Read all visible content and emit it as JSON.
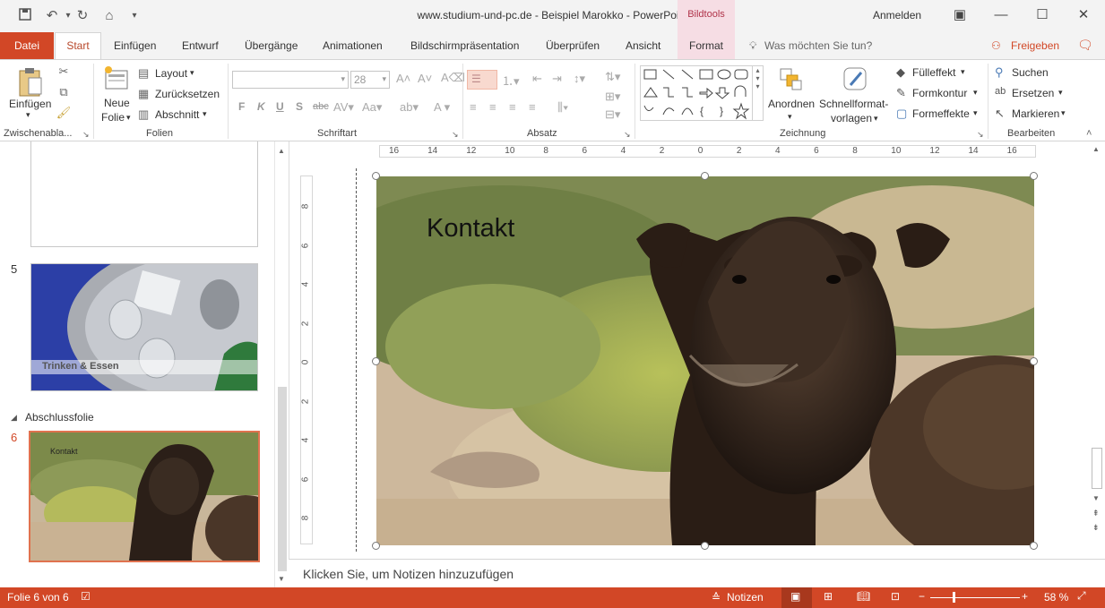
{
  "window": {
    "title": "www.studium-und-pc.de - Beispiel Marokko  -  PowerPoint",
    "contextual_group": "Bildtools",
    "sign_in": "Anmelden"
  },
  "tabs": {
    "file": "Datei",
    "items": [
      "Start",
      "Einfügen",
      "Entwurf",
      "Übergänge",
      "Animationen",
      "Bildschirmpräsentation",
      "Überprüfen",
      "Ansicht"
    ],
    "format": "Format",
    "tell_me": "Was möchten Sie tun?",
    "share": "Freigeben"
  },
  "ribbon": {
    "clipboard": {
      "paste": "Einfügen",
      "label": "Zwischenabla..."
    },
    "slides": {
      "new_slide_1": "Neue",
      "new_slide_2": "Folie",
      "layout": "Layout",
      "reset": "Zurücksetzen",
      "section": "Abschnitt",
      "label": "Folien"
    },
    "font": {
      "size": "28",
      "label": "Schriftart",
      "bold": "F",
      "italic": "K",
      "underline": "U",
      "shadow": "S",
      "strike": "abc"
    },
    "paragraph": {
      "label": "Absatz"
    },
    "drawing": {
      "arrange": "Anordnen",
      "quick_styles_1": "Schnellformat-",
      "quick_styles_2": "vorlagen",
      "fill": "Fülleffekt",
      "outline": "Formkontur",
      "effects": "Formeffekte",
      "label": "Zeichnung"
    },
    "editing": {
      "find": "Suchen",
      "replace": "Ersetzen",
      "select": "Markieren",
      "label": "Bearbeiten"
    }
  },
  "thumbnails": {
    "slide5_num": "5",
    "slide5_caption": "Trinken & Essen",
    "section_name": "Abschlussfolie",
    "slide6_num": "6",
    "slide6_caption": "Kontakt"
  },
  "rulers": {
    "h_ticks": [
      "16",
      "14",
      "12",
      "10",
      "8",
      "6",
      "4",
      "2",
      "0",
      "2",
      "4",
      "6",
      "8",
      "10",
      "12",
      "14",
      "16"
    ],
    "v_ticks": [
      "8",
      "6",
      "4",
      "2",
      "0",
      "2",
      "4",
      "6",
      "8"
    ]
  },
  "slide": {
    "title": "Kontakt"
  },
  "notes": {
    "placeholder": "Klicken Sie, um Notizen hinzuzufügen"
  },
  "status": {
    "slide_info": "Folie 6 von 6",
    "notes": "Notizen",
    "zoom": "58 %"
  },
  "colors": {
    "accent": "#d24726",
    "contextual": "#f6dde4"
  }
}
